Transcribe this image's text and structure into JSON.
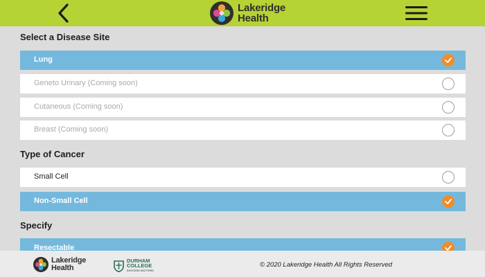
{
  "header": {
    "brand_line1": "Lakeridge",
    "brand_line2": "Health"
  },
  "sections": {
    "disease": {
      "title": "Select a Disease Site",
      "options": [
        {
          "label": "Lung",
          "selected": true,
          "disabled": false
        },
        {
          "label": "Geneto Urinary (Coming soon)",
          "selected": false,
          "disabled": true
        },
        {
          "label": "Cutaneous (Coming soon)",
          "selected": false,
          "disabled": true
        },
        {
          "label": "Breast (Coming soon)",
          "selected": false,
          "disabled": true
        }
      ]
    },
    "cancer_type": {
      "title": "Type of Cancer",
      "options": [
        {
          "label": "Small Cell",
          "selected": false,
          "disabled": false
        },
        {
          "label": "Non-Small Cell",
          "selected": true,
          "disabled": false
        }
      ]
    },
    "specify": {
      "title": "Specify",
      "options": [
        {
          "label": "Resectable",
          "selected": true,
          "disabled": false
        }
      ]
    }
  },
  "footer": {
    "brand_line1": "Lakeridge",
    "brand_line2": "Health",
    "college_line1": "DURHAM",
    "college_line2": "COLLEGE",
    "college_tagline": "SUCCESS MATTERS",
    "copyright": "© 2020 Lakeridge Health All Rights Reserved"
  },
  "colors": {
    "header_bg": "#b5d334",
    "selected_row": "#74b9dd",
    "check_orange": "#f28c27",
    "page_bg": "#dcdcdc",
    "footer_bg": "#ebebeb"
  },
  "icons": {
    "back": "chevron-left-icon",
    "menu": "hamburger-menu-icon",
    "check": "checkmark-icon"
  }
}
